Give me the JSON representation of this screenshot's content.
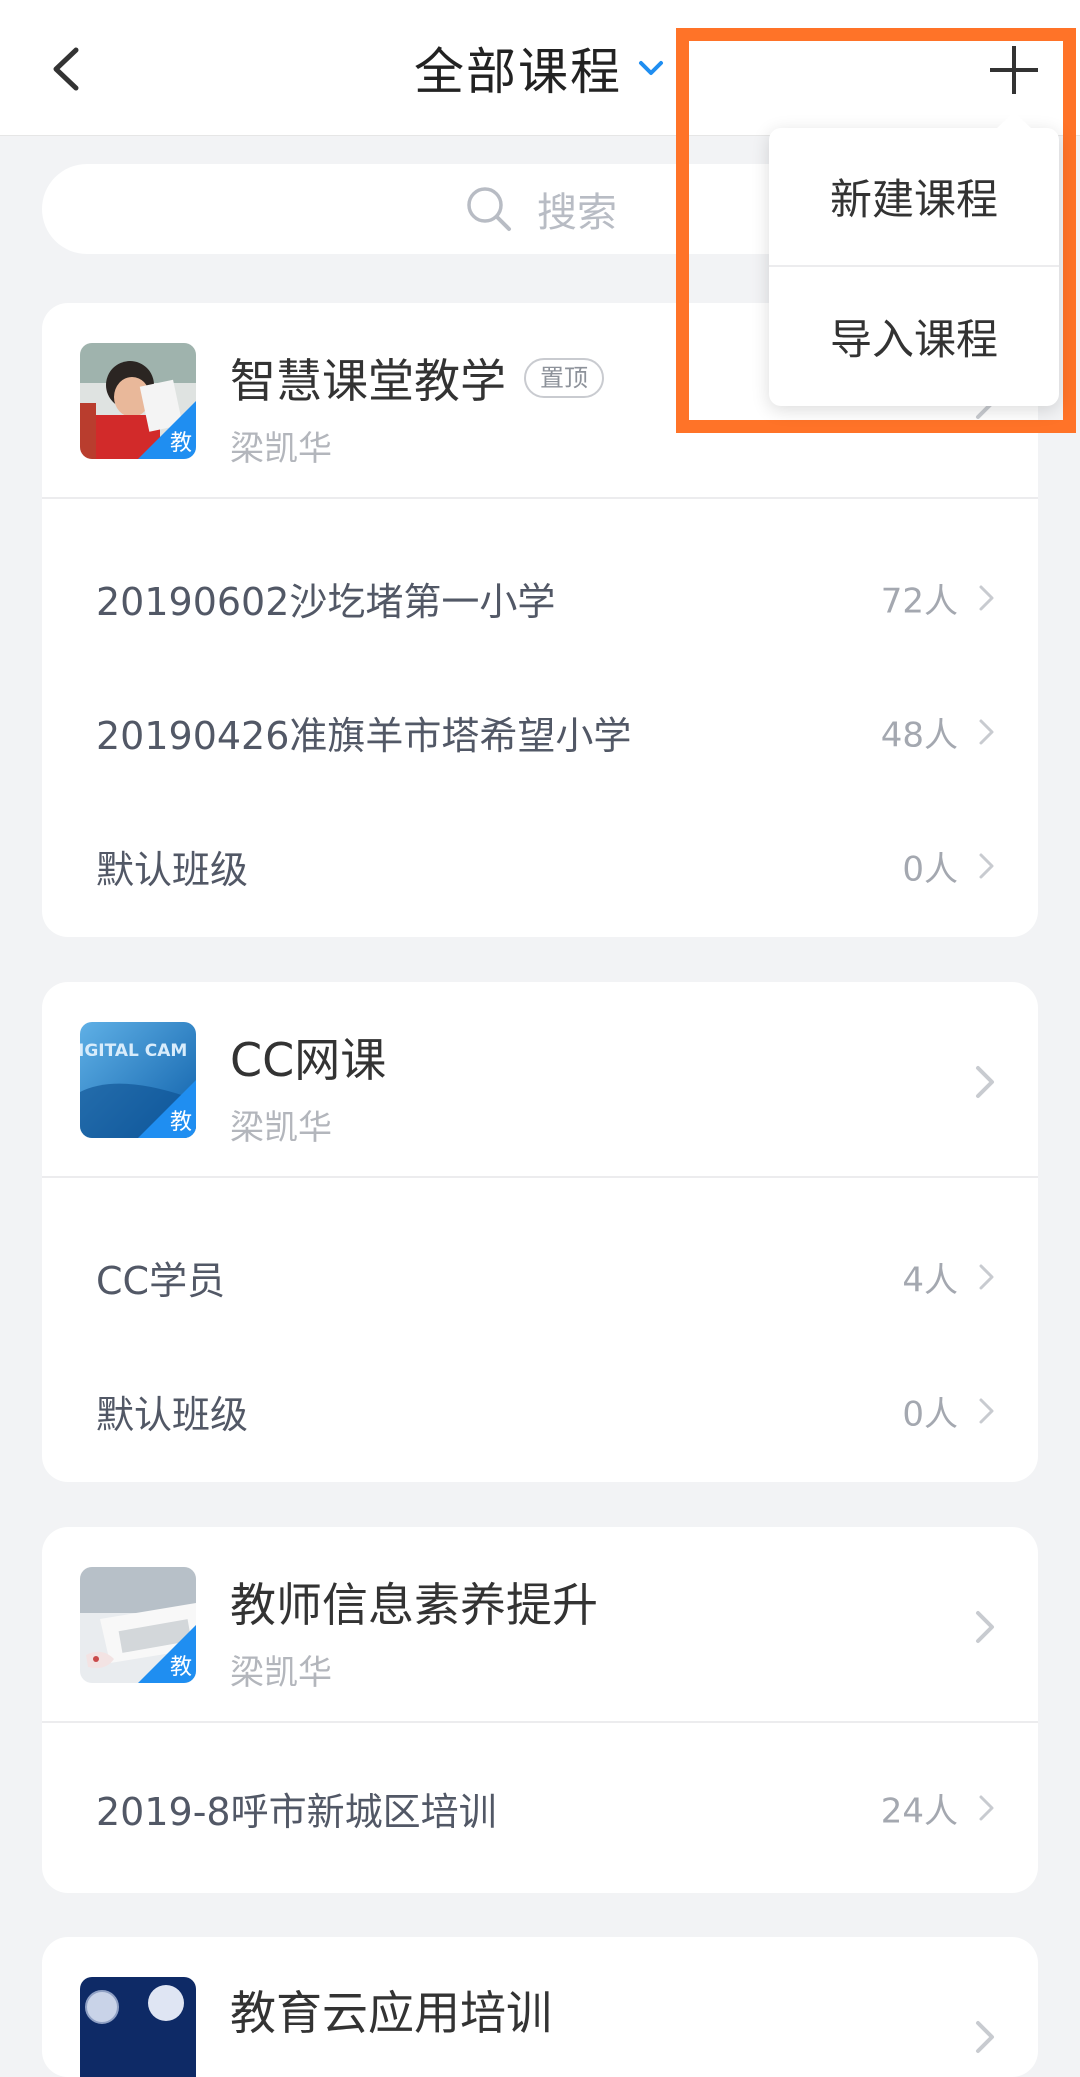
{
  "header": {
    "title": "全部课程"
  },
  "search": {
    "placeholder": "搜索"
  },
  "courses": [
    {
      "title": "智慧课堂教学",
      "tag": "置顶",
      "teacher": "梁凯华",
      "badge": "教",
      "thumb_text": "",
      "classes": [
        {
          "name": "20190602沙圪堵第一小学",
          "count": "72人"
        },
        {
          "name": "20190426准旗羊市塔希望小学",
          "count": "48人"
        },
        {
          "name": "默认班级",
          "count": "0人"
        }
      ]
    },
    {
      "title": "CC网课",
      "teacher": "梁凯华",
      "badge": "教",
      "thumb_text": "IGITAL CAM",
      "classes": [
        {
          "name": "CC学员",
          "count": "4人"
        },
        {
          "name": "默认班级",
          "count": "0人"
        }
      ]
    },
    {
      "title": "教师信息素养提升",
      "teacher": "梁凯华",
      "badge": "教",
      "thumb_text": "",
      "classes": [
        {
          "name": "2019-8呼市新城区培训",
          "count": "24人"
        }
      ]
    },
    {
      "title": "教育云应用培训",
      "teacher": "",
      "badge": "",
      "thumb_text": "",
      "classes": []
    }
  ],
  "add_menu": {
    "items": [
      {
        "label": "新建课程"
      },
      {
        "label": "导入课程"
      }
    ]
  },
  "colors": {
    "accent_blue": "#1f8ef1",
    "highlight_orange": "#ff7328",
    "background": "#f2f3f5"
  }
}
